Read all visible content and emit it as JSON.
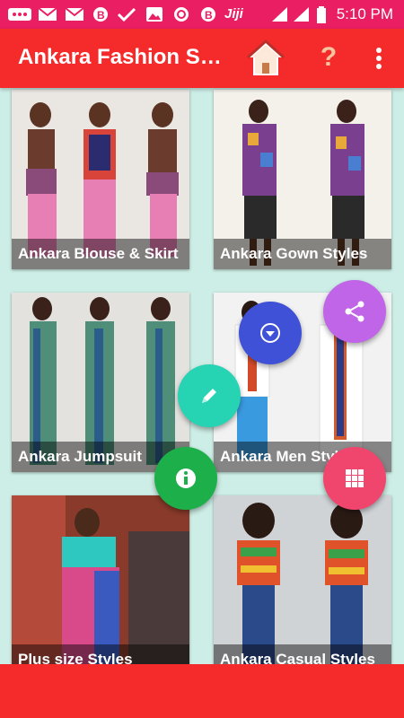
{
  "status_bar": {
    "time": "5:10 PM",
    "network_label": "Jiji"
  },
  "app_bar": {
    "title": "Ankara Fashion St…"
  },
  "categories": [
    {
      "label": "Ankara Blouse & Skirt"
    },
    {
      "label": "Ankara Gown Styles"
    },
    {
      "label": "Ankara Jumpsuit"
    },
    {
      "label": "Ankara Men Styles"
    },
    {
      "label": "Plus size Styles"
    },
    {
      "label": "Ankara Casual Styles"
    }
  ],
  "fabs": [
    {
      "icon": "share-icon",
      "color": "#c064e8"
    },
    {
      "icon": "dropdown-icon",
      "color": "#3f51d6"
    },
    {
      "icon": "pencil-icon",
      "color": "#26d3b3"
    },
    {
      "icon": "info-icon",
      "color": "#1db04a"
    },
    {
      "icon": "grid-icon",
      "color": "#f0466e"
    }
  ],
  "colors": {
    "status_bar": "#e91e63",
    "app_bar": "#f52a2a",
    "background": "#cdeee6"
  }
}
